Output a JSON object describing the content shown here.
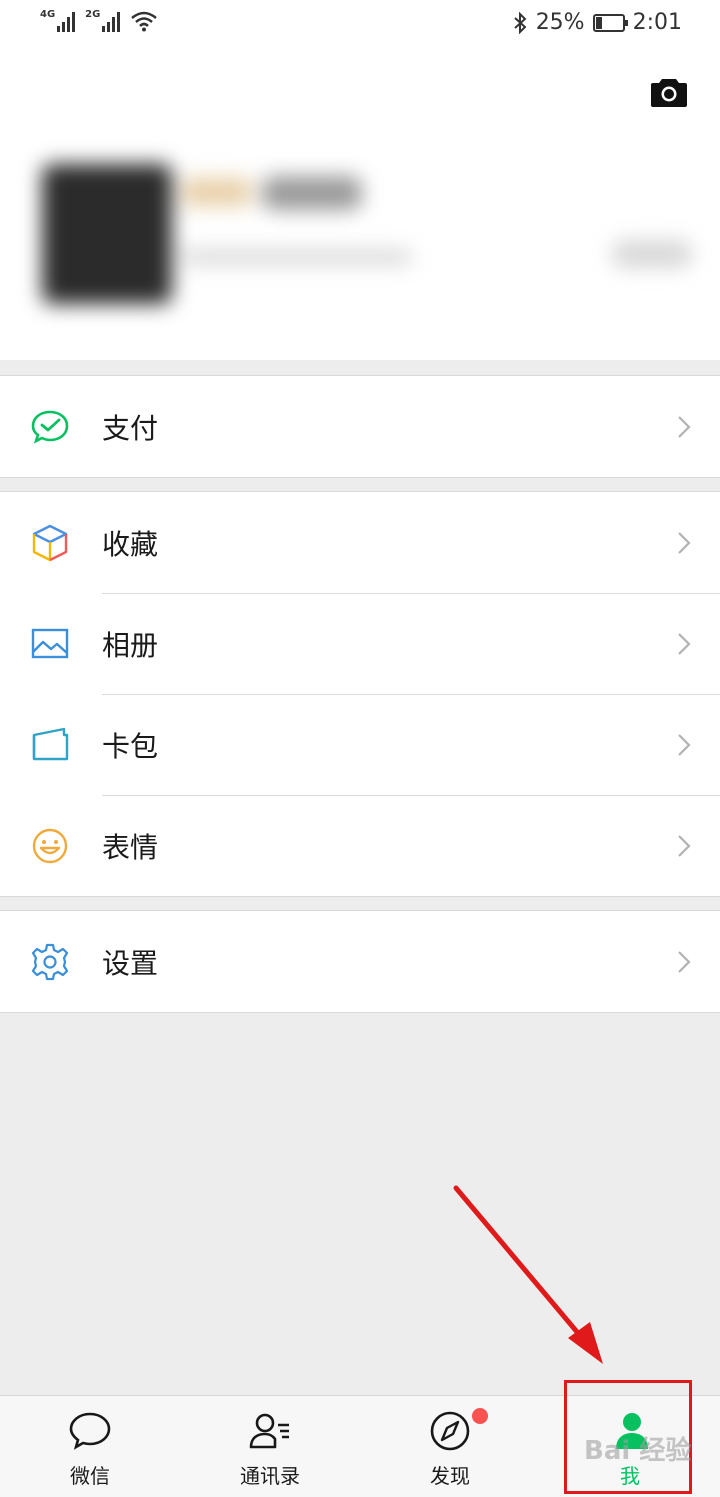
{
  "status_bar": {
    "network_1": "4G",
    "network_2": "2G",
    "battery_percent": "25%",
    "battery_level": 0.25,
    "time": "2:01"
  },
  "menu": {
    "groups": [
      [
        {
          "label": "支付",
          "icon": "wechat-pay-icon"
        }
      ],
      [
        {
          "label": "收藏",
          "icon": "favorites-cube-icon"
        },
        {
          "label": "相册",
          "icon": "album-picture-icon"
        },
        {
          "label": "卡包",
          "icon": "card-wallet-icon"
        },
        {
          "label": "表情",
          "icon": "sticker-smile-icon"
        }
      ],
      [
        {
          "label": "设置",
          "icon": "settings-gear-icon"
        }
      ]
    ]
  },
  "tabbar": {
    "items": [
      {
        "label": "微信",
        "icon": "chat-bubble-icon",
        "active": false
      },
      {
        "label": "通讯录",
        "icon": "contacts-icon",
        "active": false
      },
      {
        "label": "发现",
        "icon": "compass-icon",
        "active": false,
        "badge": true
      },
      {
        "label": "我",
        "icon": "me-person-icon",
        "active": true
      }
    ]
  },
  "colors": {
    "accent": "#07c160",
    "badge": "#fa5151",
    "annotation": "#e01a1a",
    "background": "#ededed"
  },
  "watermark": "Bai 经验"
}
